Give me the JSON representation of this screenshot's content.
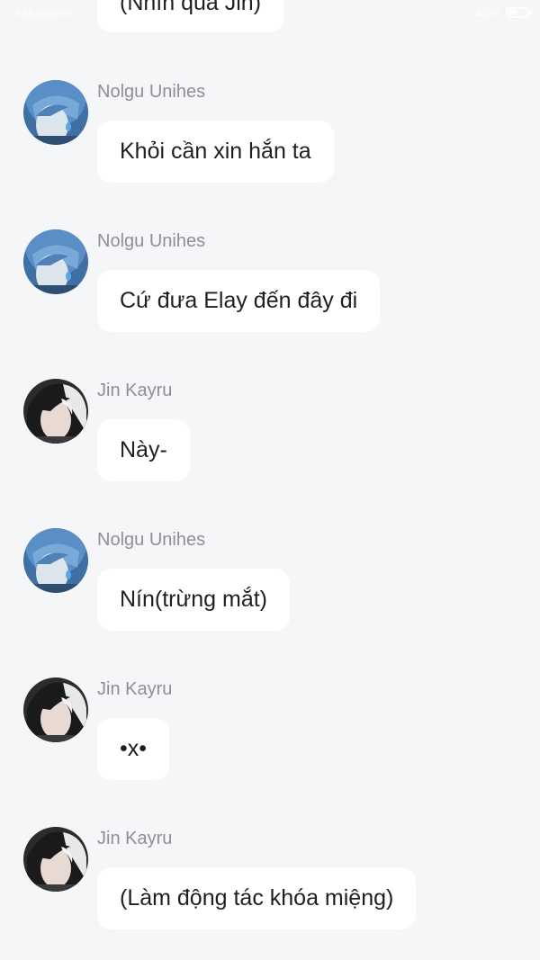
{
  "status_bar": {
    "carrier": "..ıl Mobifone",
    "battery_label": "48%",
    "battery_level": 0.48
  },
  "partial_message": {
    "text": "(Nhìn qua Jin)"
  },
  "messages": [
    {
      "sender": "Nolgu Unihes",
      "text": "Khỏi cần xin hắn ta",
      "avatar": "blue-hair-avatar"
    },
    {
      "sender": "Nolgu Unihes",
      "text": "Cứ đưa Elay đến đây đi",
      "avatar": "blue-hair-avatar"
    },
    {
      "sender": "Jin Kayru",
      "text": "Này-",
      "avatar": "black-white-hair-avatar"
    },
    {
      "sender": "Nolgu Unihes",
      "text": "Nín(trừng mắt)",
      "avatar": "blue-hair-avatar"
    },
    {
      "sender": "Jin Kayru",
      "text": "•x•",
      "avatar": "black-white-hair-avatar"
    },
    {
      "sender": "Jin Kayru",
      "text": "(Làm động tác khóa miệng)",
      "avatar": "black-white-hair-avatar"
    }
  ]
}
